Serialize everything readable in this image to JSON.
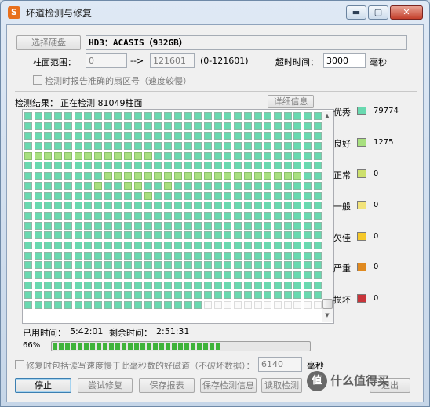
{
  "window": {
    "title": "坏道检测与修复",
    "app_icon": "S",
    "controls": {
      "minimize": "▬",
      "maximize": "▢",
      "close": "✕"
    }
  },
  "disk": {
    "select_button": "选择硬盘",
    "name": "HD3：ACASIS（932GB）"
  },
  "range": {
    "label": "柱面范围：",
    "start": "0",
    "arrow": "-->",
    "end": "121601",
    "hint": "(0-121601)"
  },
  "timeout": {
    "label": "超时时间：",
    "value": "3000",
    "unit": "毫秒"
  },
  "report_sector_option": "检测时报告准确的扇区号（速度较慢）",
  "result": {
    "label": "检测结果：",
    "status": "正在检测  81049柱面",
    "details_button": "详细信息"
  },
  "grid": {
    "cells_per_row": 30,
    "total_cells": 600,
    "completed_cells": 588,
    "good_cells": [
      120,
      121,
      122,
      123,
      124,
      125,
      126,
      127,
      128,
      129,
      130,
      131,
      132,
      188,
      189,
      190,
      191,
      192,
      193,
      194,
      195,
      196,
      197,
      198,
      199,
      200,
      201,
      202,
      203,
      204,
      205,
      206,
      207,
      217,
      220,
      221,
      224,
      252
    ],
    "normal_cells": [],
    "icons": {
      "scroll_up": "▲",
      "scroll_down": "▼"
    }
  },
  "legend": [
    {
      "label": "优秀",
      "count": "79774",
      "color": "#69d9b0"
    },
    {
      "label": "良好",
      "count": "1275",
      "color": "#a8e07f"
    },
    {
      "label": "正常",
      "count": "0",
      "color": "#cde06d"
    },
    {
      "label": "一般",
      "count": "0",
      "color": "#f2e37a"
    },
    {
      "label": "欠佳",
      "count": "0",
      "color": "#f5c82a"
    },
    {
      "label": "严重",
      "count": "0",
      "color": "#e08a20"
    },
    {
      "label": "损坏",
      "count": "0",
      "color": "#c8343a"
    }
  ],
  "time": {
    "elapsed_label": "已用时间：",
    "elapsed": "5:42:01",
    "remaining_label": "剩余时间：",
    "remaining": "2:51:31"
  },
  "progress": {
    "percent_text": "66%",
    "fraction": 0.66
  },
  "repair_option": {
    "label": "修复时包括读写速度慢于此毫秒数的好磁道（不破坏数据）：",
    "value": "6140",
    "unit": "毫秒"
  },
  "buttons": {
    "stop": "停止",
    "try_repair": "尝试修复",
    "save_report": "保存报表",
    "save_result": "保存检测信息",
    "read_result": "读取检测",
    "exit": "退出"
  },
  "watermark": {
    "glyph": "值",
    "text": "什么值得买"
  }
}
